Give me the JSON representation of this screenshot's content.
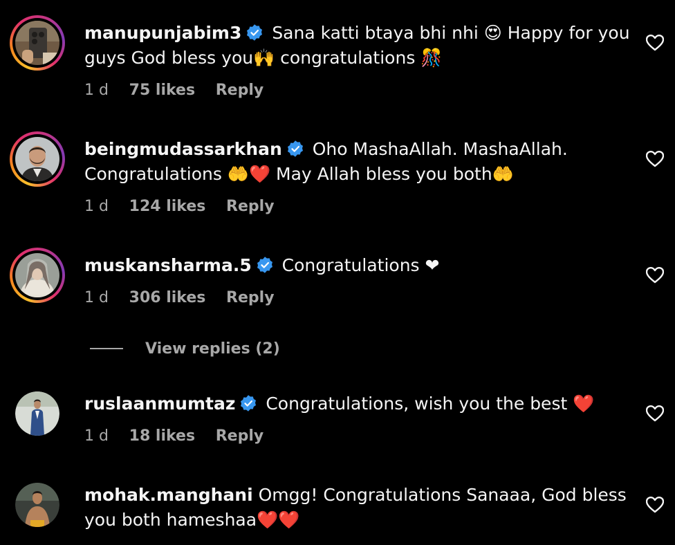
{
  "comments": [
    {
      "username": "manupunjabim3",
      "verified": true,
      "text": "Sana katti btaya bhi nhi 😍 Happy for you guys God bless you🙌 congratulations 🎊",
      "time": "1 d",
      "likes": "75 likes",
      "reply": "Reply",
      "avatar_icon": "selfie-phone-avatar",
      "story_ring": true
    },
    {
      "username": "beingmudassarkhan",
      "verified": true,
      "text": "Oho MashaAllah. MashaAllah. Congratulations 🤲❤️ May Allah bless you both🤲",
      "time": "1 d",
      "likes": "124 likes",
      "reply": "Reply",
      "avatar_icon": "bearded-man-avatar",
      "story_ring": true
    },
    {
      "username": "muskansharma.5",
      "verified": true,
      "text": "Congratulations ❤",
      "time": "1 d",
      "likes": "306 likes",
      "reply": "Reply",
      "avatar_icon": "bride-avatar",
      "story_ring": true
    },
    {
      "username": "ruslaanmumtaz",
      "verified": true,
      "text": "Congratulations, wish you the best ❤️",
      "time": "1 d",
      "likes": "18 likes",
      "reply": "Reply",
      "avatar_icon": "man-in-suit-avatar",
      "story_ring": false
    },
    {
      "username": "mohak.manghani",
      "verified": false,
      "text": "Omgg! Congratulations Sanaaa, God bless you both hameshaa❤️❤️",
      "avatar_icon": "shirtless-man-avatar",
      "story_ring": false
    }
  ],
  "view_replies": "View replies (2)",
  "colors": {
    "background": "#000000",
    "text": "#f5f5f5",
    "secondary": "#a8a8a8",
    "verified": "#3897f0"
  },
  "icons": {
    "like": "heart-outline-icon",
    "verified": "verified-badge-icon"
  }
}
